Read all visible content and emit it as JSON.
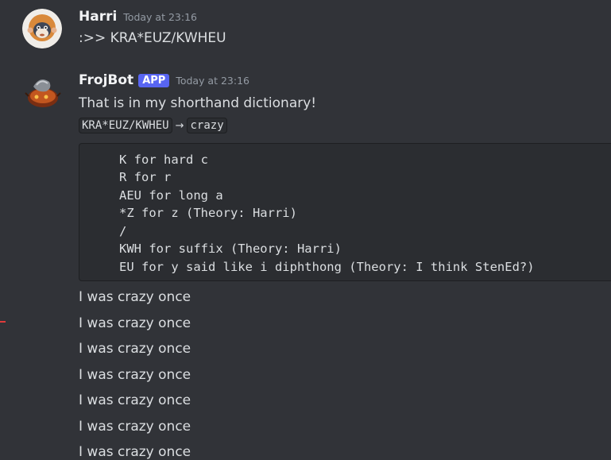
{
  "messages": [
    {
      "username": "Harri",
      "timestamp": "Today at 23:16",
      "text": ":>> KRA*EUZ/KWHEU",
      "avatar_icon": "monkey-avatar-icon"
    },
    {
      "username": "FrojBot",
      "badge": "APP",
      "timestamp": "Today at 23:16",
      "text": "That is in my shorthand dictionary!",
      "stroke": "KRA*EUZ/KWHEU",
      "arrow": "→",
      "translation": "crazy",
      "avatar_icon": "frog-bot-avatar-icon",
      "code_lines": [
        "K for hard c",
        "R for r",
        "AEU for long a",
        "*Z for z (Theory: Harri)",
        "/",
        "KWH for suffix (Theory: Harri)",
        "EU for y said like i diphthong (Theory: I think StenEd?)"
      ]
    }
  ],
  "repeated_lines": [
    "I was crazy once",
    "I was crazy once",
    "I was crazy once",
    "I was crazy once",
    "I was crazy once",
    "I was crazy once",
    "I was crazy once"
  ],
  "colors": {
    "background": "#313338",
    "text": "#dbdee1",
    "username": "#f2f3f5",
    "timestamp": "#949ba4",
    "app_badge": "#5865f2",
    "code_background": "#2b2d31"
  }
}
